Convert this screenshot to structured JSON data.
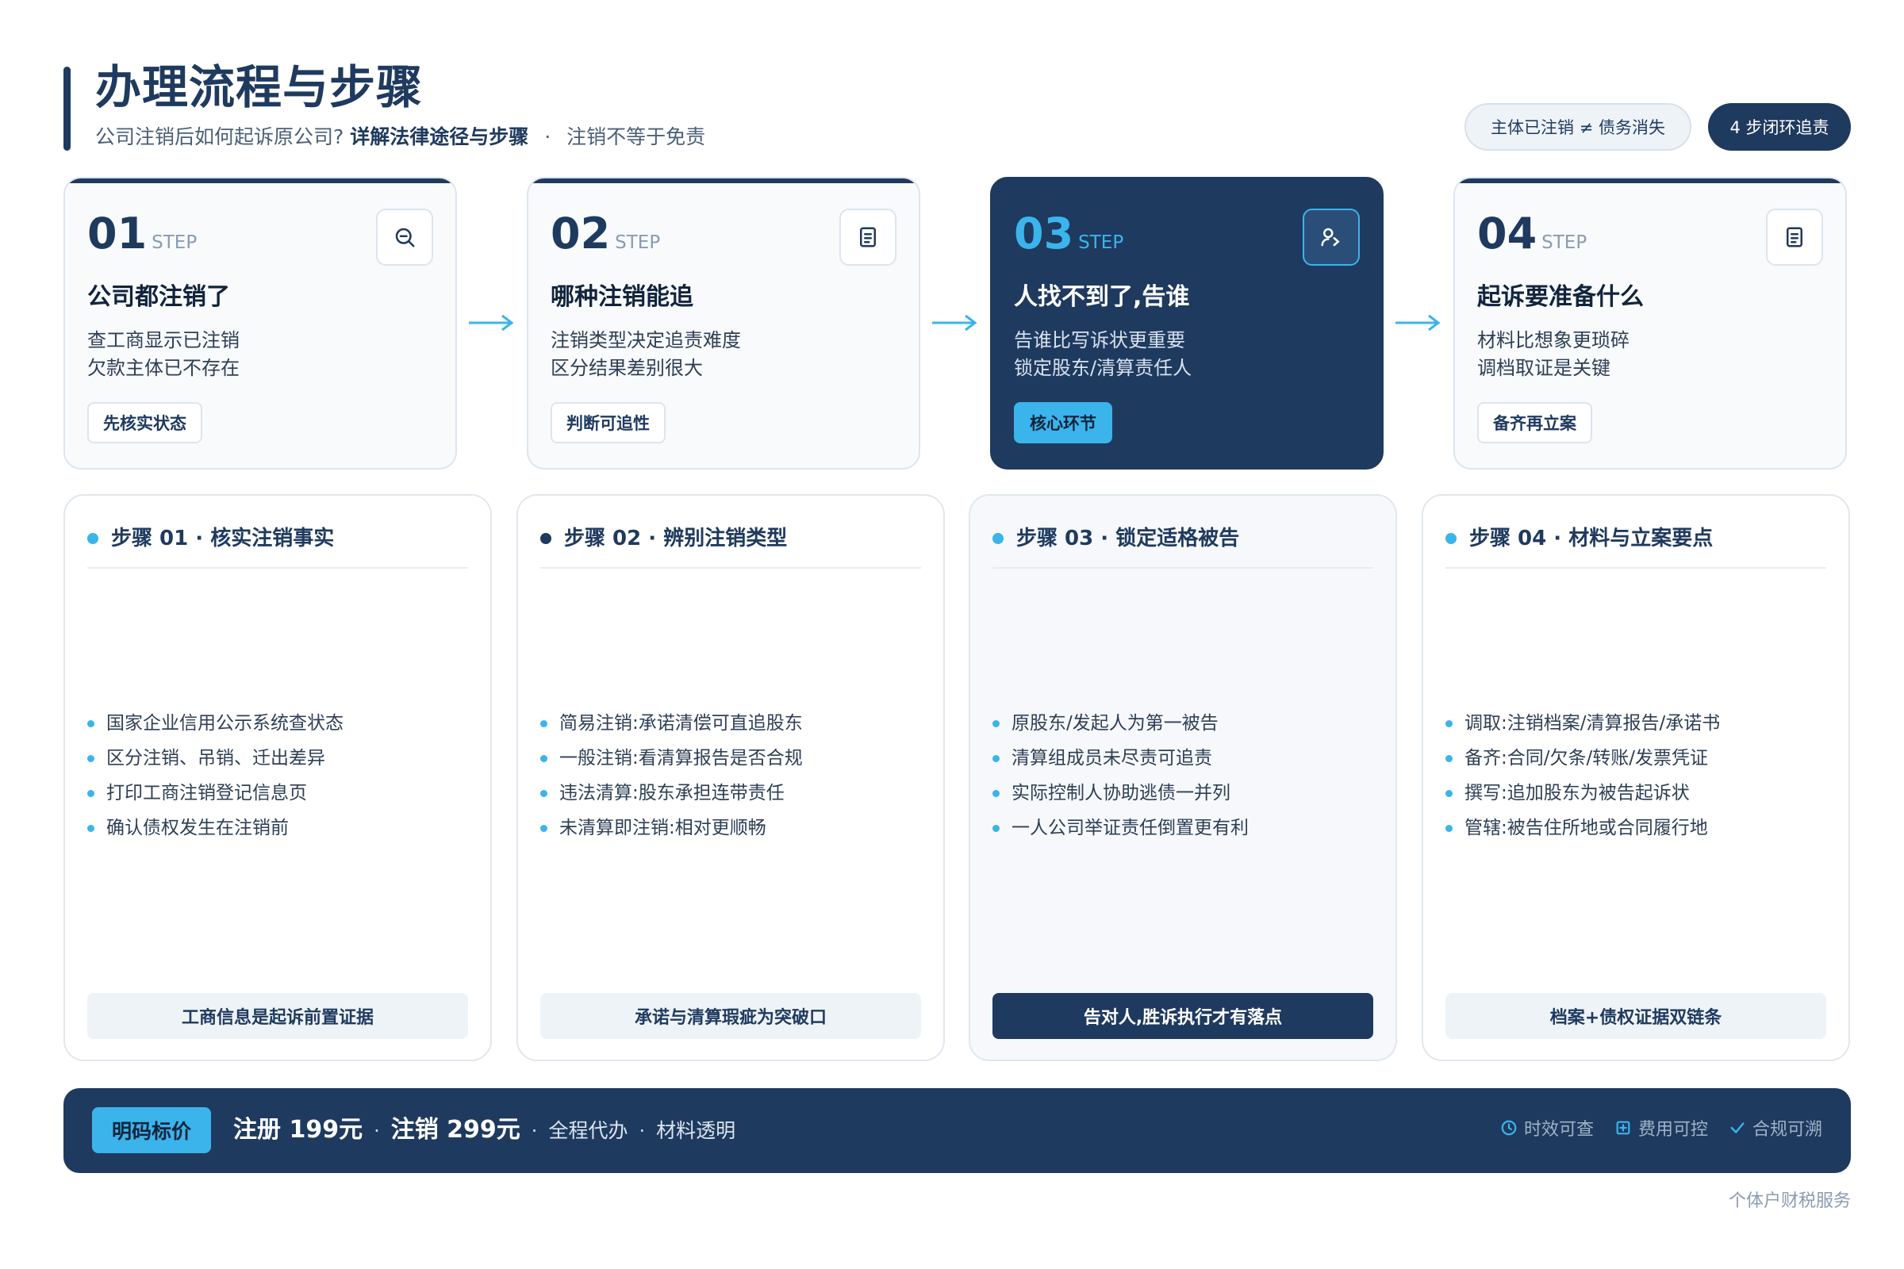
{
  "header": {
    "title": "办理流程与步骤",
    "subtitle_lead": "公司注销后如何起诉原公司?",
    "subtitle_strong": "详解法律途径与步骤",
    "subtitle_sep": "·",
    "subtitle_tail": "注销不等于免责",
    "pill_light": "主体已注销 ≠ 债务消失",
    "pill_dark": "4 步闭环追责"
  },
  "steps": [
    {
      "num": "01",
      "word": "STEP",
      "icon": "search-minus-icon",
      "name": "公司都注销了",
      "line1": "查工商显示已注销",
      "line2": "欠款主体已不存在",
      "tag": "先核实状态"
    },
    {
      "num": "02",
      "word": "STEP",
      "icon": "document-icon",
      "name": "哪种注销能追",
      "line1": "注销类型决定追责难度",
      "line2": "区分结果差别很大",
      "tag": "判断可追性"
    },
    {
      "num": "03",
      "word": "STEP",
      "icon": "user-arrow-icon",
      "name": "人找不到了,告谁",
      "line1": "告谁比写诉状更重要",
      "line2": "锁定股东/清算责任人",
      "tag": "核心环节"
    },
    {
      "num": "04",
      "word": "STEP",
      "icon": "document-icon",
      "name": "起诉要准备什么",
      "line1": "材料比想象更琐碎",
      "line2": "调档取证是关键",
      "tag": "备齐再立案"
    }
  ],
  "details": [
    {
      "title": "步骤 01 · 核实注销事实",
      "items": [
        "国家企业信用公示系统查状态",
        "区分注销、吊销、迁出差异",
        "打印工商注销登记信息页",
        "确认债权发生在注销前"
      ],
      "foot": "工商信息是起诉前置证据"
    },
    {
      "title": "步骤 02 · 辨别注销类型",
      "items": [
        "简易注销:承诺清偿可直追股东",
        "一般注销:看清算报告是否合规",
        "违法清算:股东承担连带责任",
        "未清算即注销:相对更顺畅"
      ],
      "foot": "承诺与清算瑕疵为突破口"
    },
    {
      "title": "步骤 03 · 锁定适格被告",
      "items": [
        "原股东/发起人为第一被告",
        "清算组成员未尽责可追责",
        "实际控制人协助逃债一并列",
        "一人公司举证责任倒置更有利"
      ],
      "foot": "告对人,胜诉执行才有落点"
    },
    {
      "title": "步骤 04 · 材料与立案要点",
      "items": [
        "调取:注销档案/清算报告/承诺书",
        "备齐:合同/欠条/转账/发票凭证",
        "撰写:追加股东为被告起诉状",
        "管辖:被告住所地或合同履行地"
      ],
      "foot": "档案+债权证据双链条"
    }
  ],
  "pricing": {
    "badge": "明码标价",
    "register": "注册 199元",
    "sep": "·",
    "cancel": "注销 299元",
    "service1": "全程代办",
    "service2": "材料透明",
    "features": [
      {
        "icon": "clock-icon",
        "label": "时效可查"
      },
      {
        "icon": "plus-square-icon",
        "label": "费用可控"
      },
      {
        "icon": "check-icon",
        "label": "合规可溯"
      }
    ]
  },
  "footer": {
    "note": "个体户财税服务"
  },
  "colors": {
    "primary": "#1f3a5f",
    "accent": "#3bb4ec",
    "muted": "#8a9cb3",
    "card_border": "#dde5ee"
  }
}
